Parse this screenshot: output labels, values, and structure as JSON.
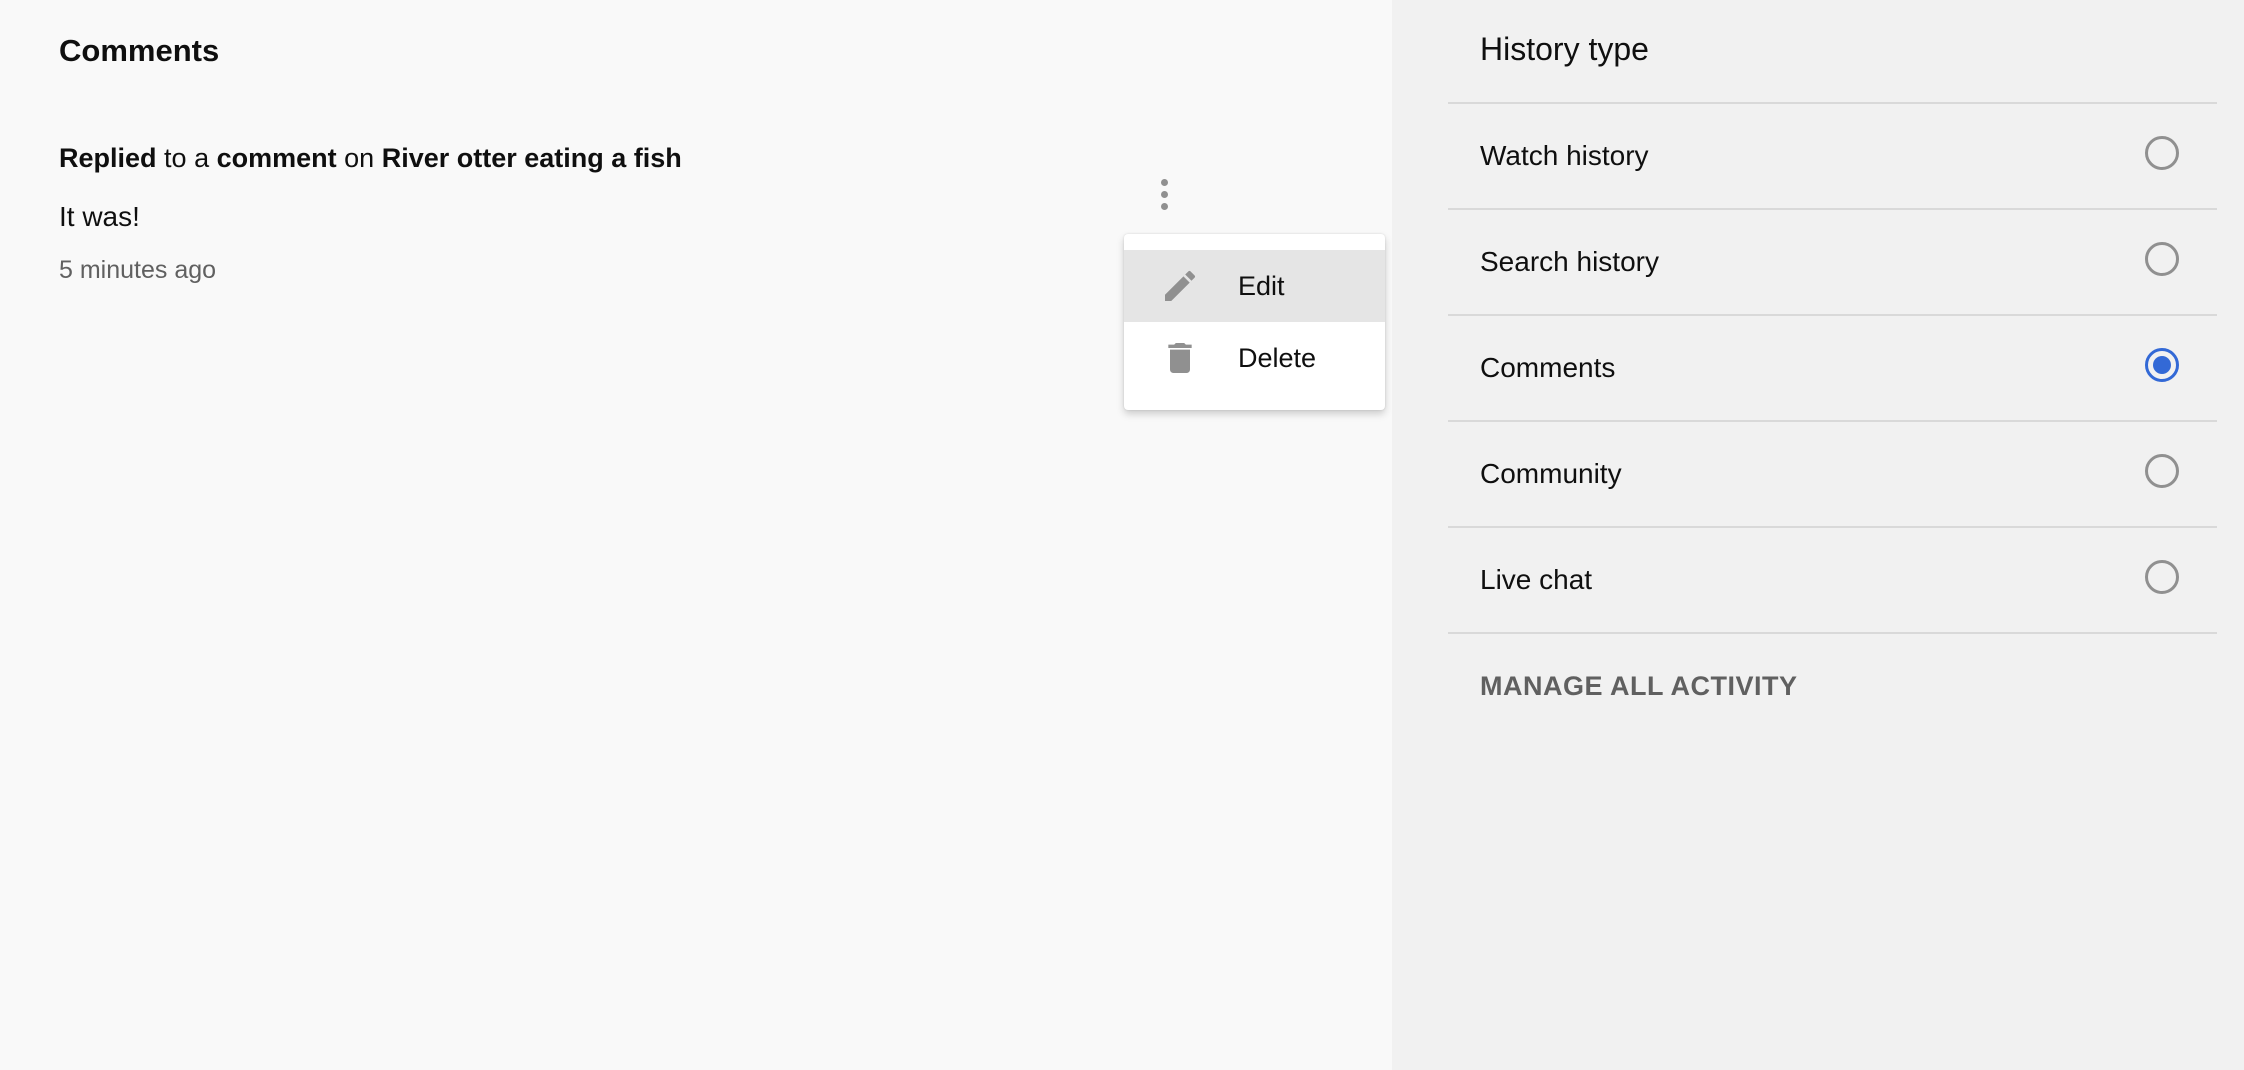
{
  "main": {
    "section_title": "Comments",
    "activity": {
      "action": "Replied",
      "to_text": "to a",
      "target": "comment",
      "on_text": "on",
      "video_title": "River otter eating a fish"
    },
    "comment_text": "It was!",
    "timestamp": "5 minutes ago",
    "more_icon": "more-vert-icon"
  },
  "menu": {
    "items": [
      {
        "label": "Edit",
        "icon": "pencil-icon",
        "highlighted": true
      },
      {
        "label": "Delete",
        "icon": "trash-icon",
        "highlighted": false
      }
    ]
  },
  "sidebar": {
    "title": "History type",
    "options": [
      {
        "label": "Watch history",
        "selected": false
      },
      {
        "label": "Search history",
        "selected": false
      },
      {
        "label": "Comments",
        "selected": true
      },
      {
        "label": "Community",
        "selected": false
      },
      {
        "label": "Live chat",
        "selected": false
      }
    ],
    "manage_link": "MANAGE ALL ACTIVITY"
  },
  "colors": {
    "main_background": "#f9f9f9",
    "sidebar_background": "#f1f1f1",
    "accent": "#3369d6",
    "secondary_text": "#606060",
    "icon_gray": "#909090"
  }
}
